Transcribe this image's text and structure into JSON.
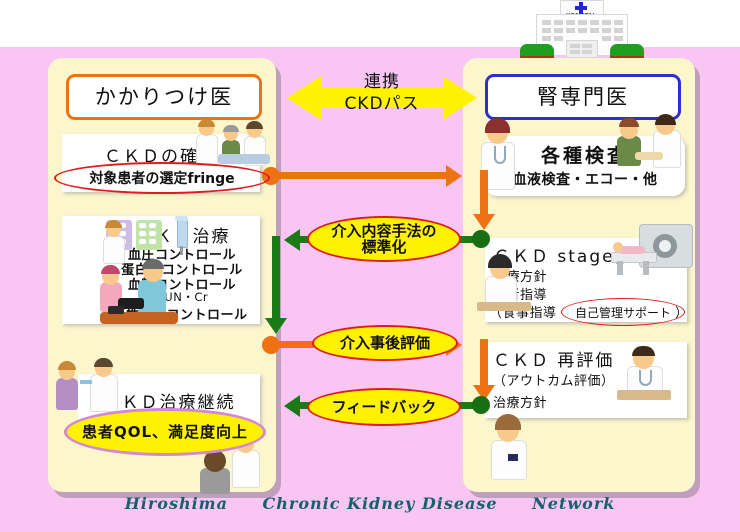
{
  "footer": {
    "word1": "Hiroshima",
    "word2": "Chronic Kidney Disease",
    "word3": "Network"
  },
  "hospital": {
    "label": "HOSPITAL",
    "icon": "hospital-building-icon"
  },
  "center_arrow": {
    "line1": "連携",
    "line2": "CKDパス",
    "color": "#fff200"
  },
  "left_panel": {
    "header": "かかりつけ医",
    "header_border_color": "#e8741a",
    "blocks": [
      {
        "title": "ＣＫＤの確認",
        "annotation": "対象患者の選定fringe"
      },
      {
        "title": "ＣＫＤ治療",
        "items": [
          "血圧コントロール",
          "蛋白尿コントロール",
          "血糖コントロール",
          "BUN・Cr",
          "腎性貧血コントロール"
        ]
      },
      {
        "title": "ＣＫＤ治療継続",
        "annotation": "患者QOL、満足度向上"
      }
    ]
  },
  "right_panel": {
    "header": "腎専門医",
    "header_border_color": "#2e2ed6",
    "blocks": [
      {
        "title": "各種検査",
        "subtitle": "血液検査・エコー・他"
      },
      {
        "title": "ＣＫＤ stage診断",
        "items": [
          "治療方針",
          "患者指導"
        ],
        "sub_prefix": "（食事指導",
        "annotation": "自己管理サポート",
        "sub_suffix": "）"
      },
      {
        "title": "ＣＫＤ 再評価",
        "items": [
          "（アウトカム評価）",
          "治療方針"
        ]
      }
    ]
  },
  "connectors": [
    {
      "label": "",
      "direction": "right",
      "color": "#ee7211"
    },
    {
      "label": "介入内容手法の標準化",
      "line1": "介入内容手法の",
      "line2": "標準化",
      "direction": "left",
      "color": "#1a7a16"
    },
    {
      "label": "介入事後評価",
      "line1": "介入事後評価",
      "line2": "",
      "direction": "right",
      "color": "#ee7211"
    },
    {
      "label": "フィードバック",
      "line1": "フィードバック",
      "line2": "",
      "direction": "left",
      "color": "#1a7a16"
    }
  ],
  "colors": {
    "background_pink": "#f9c6f4",
    "panel_cream": "#fcf6cd",
    "orange": "#ee7211",
    "green": "#1a7a16",
    "yellow": "#fff200",
    "red": "#e01b1b",
    "violet": "#d487d4",
    "footer_text": "#15616b"
  }
}
